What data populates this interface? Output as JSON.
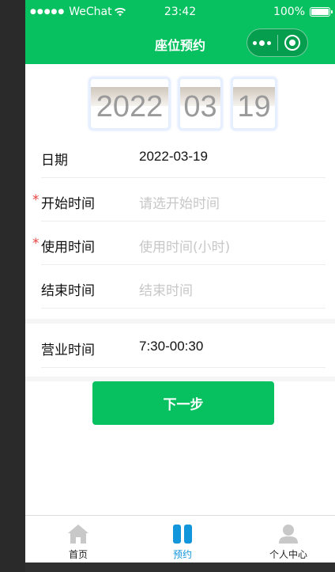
{
  "status_bar": {
    "signal": "●●●●●",
    "carrier": "WeChat",
    "time": "23:42",
    "battery": "100%"
  },
  "nav": {
    "title": "座位预约"
  },
  "date_cards": {
    "year": "2022",
    "month": "03",
    "day": "19"
  },
  "form": {
    "date": {
      "label": "日期",
      "value": "2022-03-19"
    },
    "start_time": {
      "required_mark": "*",
      "label": "开始时间",
      "placeholder": "请选开始时间"
    },
    "duration": {
      "required_mark": "*",
      "label": "使用时间",
      "placeholder": "使用时间(小时)"
    },
    "end_time": {
      "label": "结束时间",
      "placeholder": "结束时间"
    },
    "business_hours": {
      "label": "营业时间",
      "value": "7:30-00:30"
    }
  },
  "next_button": {
    "label": "下一步"
  },
  "tabbar": {
    "items": [
      {
        "label": "首页",
        "icon": "home-icon",
        "active": false
      },
      {
        "label": "预约",
        "icon": "booking-icon",
        "active": true
      },
      {
        "label": "个人中心",
        "icon": "user-icon",
        "active": false
      }
    ]
  },
  "colors": {
    "brand": "#07c160",
    "required": "#e64340",
    "tab_active": "#1296db",
    "tab_inactive": "#cccccc"
  }
}
